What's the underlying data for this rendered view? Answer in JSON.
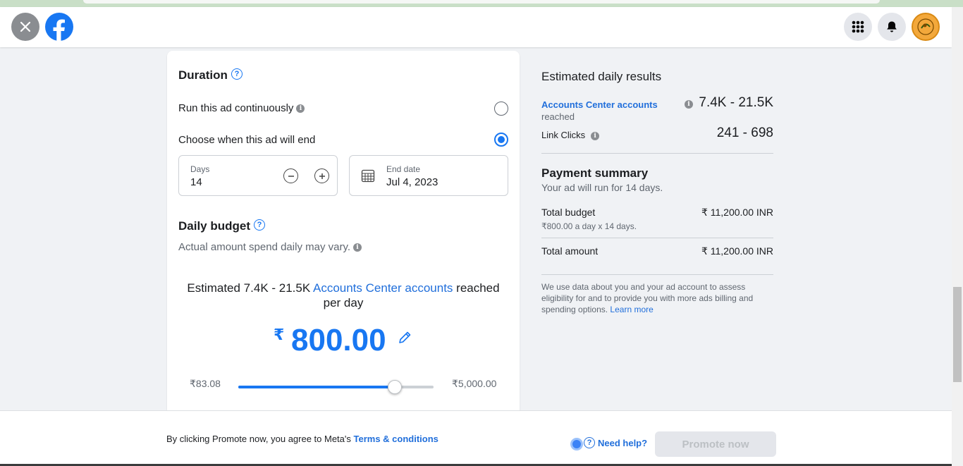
{
  "header": {
    "close_icon": "close-icon",
    "logo_icon": "facebook-logo",
    "menu_icon": "grid-menu-icon",
    "notifications_icon": "bell-icon"
  },
  "duration": {
    "title": "Duration",
    "option_continuous": "Run this ad continuously",
    "option_end": "Choose when this ad will end",
    "selected": "end",
    "days_label": "Days",
    "days_value": "14",
    "end_date_label": "End date",
    "end_date_value": "Jul 4, 2023"
  },
  "budget": {
    "title": "Daily budget",
    "subtitle": "Actual amount spend daily may vary.",
    "estimate_prefix": "Estimated 7.4K - 21.5K ",
    "estimate_link": "Accounts Center accounts",
    "estimate_suffix": " reached per day",
    "currency_symbol": "₹",
    "amount": "800.00",
    "slider_min": "₹83.08",
    "slider_max": "₹5,000.00",
    "slider_fraction": 0.8
  },
  "results": {
    "title": "Estimated daily results",
    "reached_link": "Accounts Center accounts",
    "reached_suffix": "reached",
    "reached_value": "7.4K - 21.5K",
    "clicks_label": "Link Clicks",
    "clicks_value": "241 - 698"
  },
  "payment": {
    "title": "Payment summary",
    "run_text": "Your ad will run for 14 days.",
    "total_budget_label": "Total budget",
    "total_budget_value": "₹ 11,200.00 INR",
    "total_budget_detail": "₹800.00 a day x 14 days.",
    "total_amount_label": "Total amount",
    "total_amount_value": "₹ 11,200.00 INR",
    "disclaimer": "We use data about you and your ad account to assess eligibility for and to provide you with more ads billing and spending options.",
    "learn_more": "Learn more"
  },
  "footer": {
    "agree_text": "By clicking Promote now, you agree to Meta's ",
    "terms_link": "Terms & conditions",
    "need_help": "Need help?",
    "promote_button": "Promote now"
  },
  "colors": {
    "accent": "#1877f2",
    "link": "#216fdb",
    "page_bg": "#f0f2f5"
  }
}
